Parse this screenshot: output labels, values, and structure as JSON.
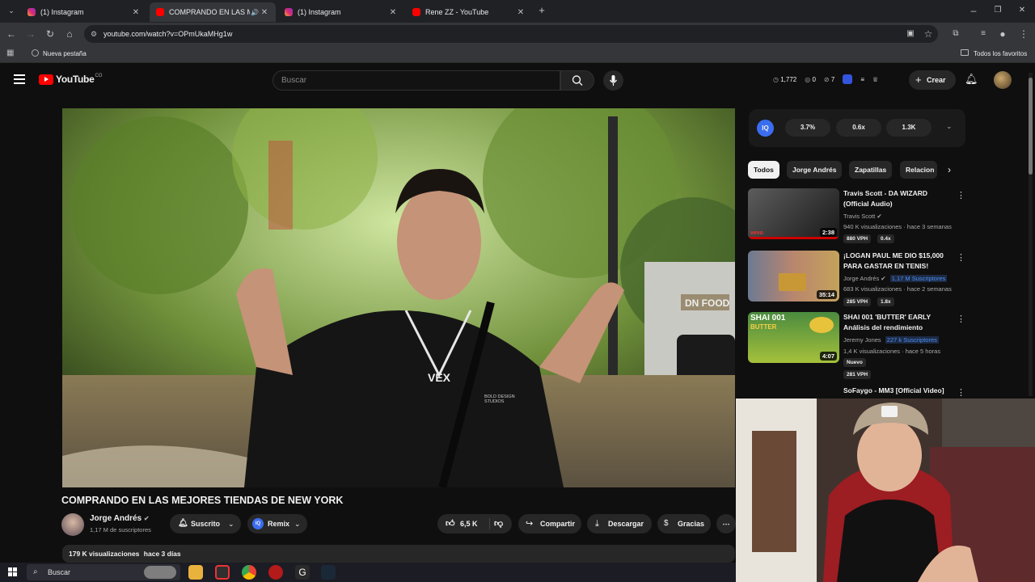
{
  "browser": {
    "tabs": [
      {
        "label": "(1) Instagram",
        "icon": "instagram-icon"
      },
      {
        "label": "COMPRANDO EN LAS MEJ",
        "icon": "youtube-icon",
        "active": true
      },
      {
        "label": "(1) Instagram",
        "icon": "instagram-icon"
      },
      {
        "label": "Rene ZZ - YouTube",
        "icon": "youtube-icon"
      }
    ],
    "url": "youtube.com/watch?v=OPmUkaMHg1w",
    "bookmark_new_tab": "Nueva pestaña",
    "all_favorites": "Todos los favoritos"
  },
  "header": {
    "logo": "YouTube",
    "logo_sup": "CO",
    "search_placeholder": "Buscar",
    "stats": {
      "s1": "1,772",
      "s2": "0",
      "s3": "7"
    },
    "create_label": "Crear"
  },
  "video": {
    "title": "COMPRANDO EN LAS MEJORES TIENDAS DE NEW YORK",
    "shirt_text": "VEX",
    "shirt_brand_line1": "BOLD DESIGN",
    "shirt_brand_line2": "STUDIOS",
    "storefront": "DN FOOD",
    "channel": "Jorge Andrés",
    "subscribers": "1,17 M de suscriptores",
    "subscribed_label": "Suscrito",
    "remix_label": "Remix",
    "likes": "6,5 K",
    "share_label": "Compartir",
    "download_label": "Descargar",
    "thanks_label": "Gracias",
    "views": "179 K visualizaciones",
    "age": "hace 3 días"
  },
  "extension": {
    "logo": "IQ",
    "values": [
      "3.7%",
      "0.6x",
      "1.3K"
    ]
  },
  "chips": [
    "Todos",
    "Jorge Andrés",
    "Zapatillas",
    "Relacion"
  ],
  "recommendations": [
    {
      "title": "Travis Scott - DA WIZARD (Official Audio)",
      "channel": "Travis Scott",
      "meta": "940 K visualizaciones · hace 3 semanas",
      "duration": "2:38",
      "vph": "880 VPH",
      "ratio": "0.4x",
      "thumb_label": "vevo"
    },
    {
      "title": "¡LOGAN PAUL ME DIO $15,000 PARA GASTAR EN TENIS!",
      "channel": "Jorge Andrés",
      "subs": "1,17 M Suscriptores",
      "meta": "683 K visualizaciones · hace 2 semanas",
      "duration": "35:14",
      "vph": "285 VPH",
      "ratio": "1.8x"
    },
    {
      "title": "SHAI 001 'BUTTER' EARLY Análisis del rendimiento",
      "channel": "Jeremy Jones",
      "subs": "227 k Suscriptores",
      "meta": "1,4 K visualizaciones · hace 5 horas",
      "duration": "4:07",
      "badge": "Nuevo",
      "vph": "281 VPH",
      "thumb_label1": "SHAI 001",
      "thumb_label2": "BUTTER"
    },
    {
      "title": "SoFaygo - MM3 [Official Video]"
    }
  ],
  "taskbar": {
    "search": "Buscar"
  }
}
